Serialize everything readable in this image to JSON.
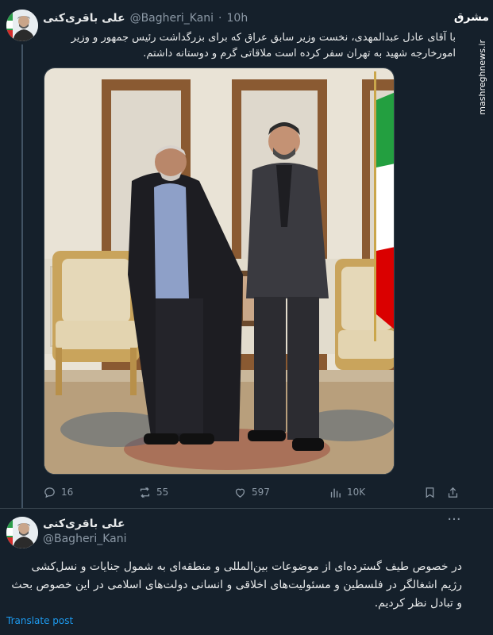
{
  "tweet1": {
    "display_name": "علی باقری‌کنی",
    "handle": "@Bagheri_Kani",
    "separator": "·",
    "time": "10h",
    "text": "با آقای عادل عبدالمهدی، نخست وزیر سابق عراق که برای بزرگداشت رئیس جمهور و وزیر امورخارجه شهید به تهران سفر کرده است ملاقاتی گرم و دوستانه داشتم.",
    "actions": {
      "replies": "16",
      "retweets": "55",
      "likes": "597",
      "views": "10K"
    }
  },
  "watermark": {
    "logo": "مشرق",
    "url": "mashreghnews.ir"
  },
  "tweet2": {
    "display_name": "علی باقری‌کنی",
    "handle": "@Bagheri_Kani",
    "more": "···",
    "text": "در خصوص طیف گسترده‌ای از موضوعات بین‌المللی و منطقه‌ای به شمول جنایات و نسل‌کشی رژیم اشغالگر در فلسطین و مسئولیت‌های اخلاقی و انسانی دولت‌های اسلامی در این خصوص بحث و تبادل نظر کردیم.",
    "translate": "Translate post"
  },
  "colors": {
    "background": "#15202b",
    "text": "#e7e9ea",
    "secondary": "#8b98a5",
    "link": "#1d9bf0",
    "border": "#38444d"
  },
  "icons": [
    "reply-icon",
    "retweet-icon",
    "like-icon",
    "views-icon",
    "bookmark-icon",
    "share-icon",
    "more-icon"
  ]
}
